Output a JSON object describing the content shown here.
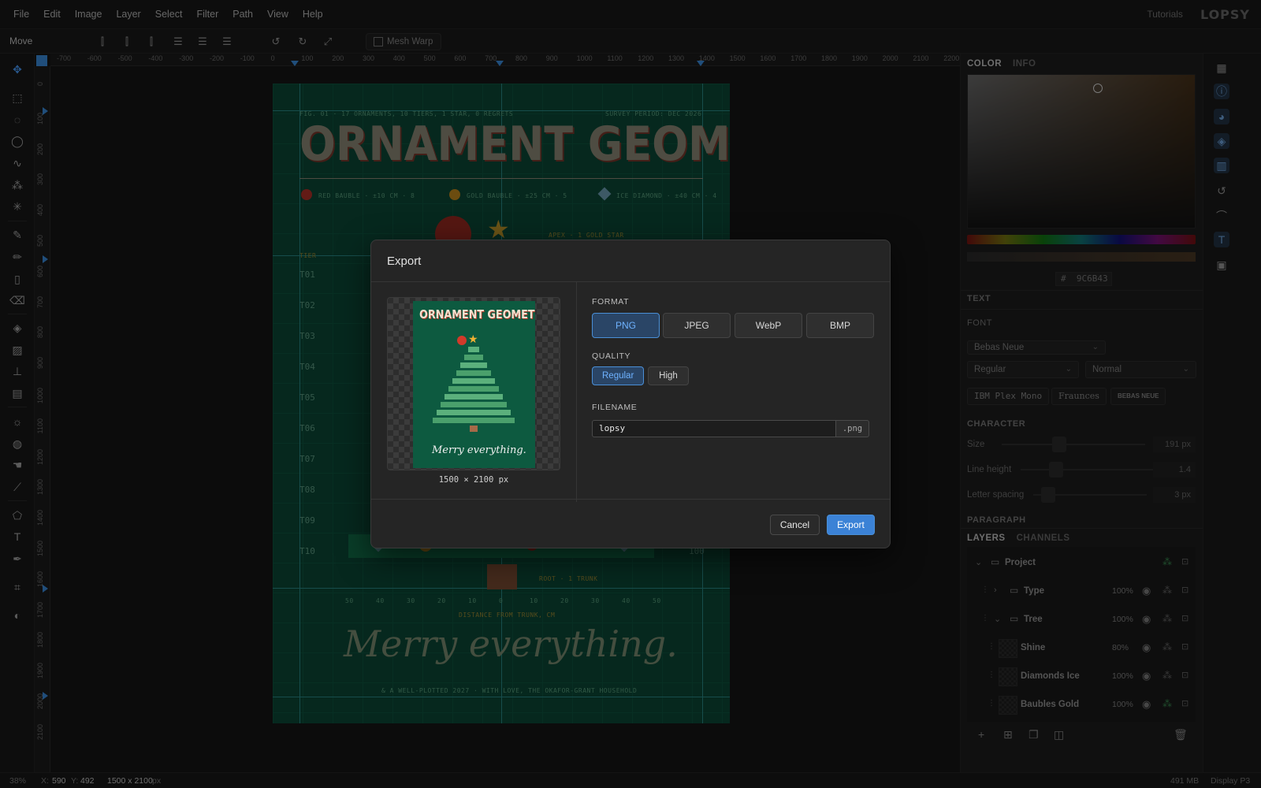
{
  "menubar": {
    "items": [
      "File",
      "Edit",
      "Image",
      "Layer",
      "Select",
      "Filter",
      "Path",
      "View",
      "Help"
    ],
    "tutorials": "Tutorials",
    "logo": "LOPSY"
  },
  "options": {
    "tool_name": "Move",
    "mesh_warp": "Mesh Warp"
  },
  "rulers": {
    "h": [
      "-700",
      "-600",
      "-500",
      "-400",
      "-300",
      "-200",
      "-100",
      "0",
      "100",
      "200",
      "300",
      "400",
      "500",
      "600",
      "700",
      "800",
      "900",
      "1000",
      "1100",
      "1200",
      "1300",
      "1400",
      "1500",
      "1600",
      "1700",
      "1800",
      "1900",
      "2000",
      "2100",
      "2200"
    ],
    "v": [
      "0",
      "100",
      "200",
      "300",
      "400",
      "500",
      "600",
      "700",
      "800",
      "900",
      "1000",
      "1100",
      "1200",
      "1300",
      "1400",
      "1500",
      "1600",
      "1700",
      "1800",
      "1900",
      "2000",
      "2100"
    ]
  },
  "poster": {
    "caption_left": "FIG. 01 · 17 ORNAMENTS, 10 TIERS, 1 STAR, 0 REGRETS",
    "caption_right": "SURVEY PERIOD: DEC 2026",
    "title": "ORNAMENT GEOMETRY",
    "legend": [
      "RED BAUBLE · ±10 CM · 8",
      "GOLD BAUBLE · ±25 CM · 5",
      "ICE DIAMOND · ±40 CM · 4"
    ],
    "apex": "APEX · 1 GOLD STAR",
    "tier_head": "TIER",
    "tiers": [
      "T01",
      "T02",
      "T03",
      "T04",
      "T05",
      "T06",
      "T07",
      "T08",
      "T09",
      "T10"
    ],
    "tier10_value": "100",
    "root": "ROOT · 1 TRUNK",
    "axis_ticks": [
      "50",
      "40",
      "30",
      "20",
      "10",
      "0",
      "10",
      "20",
      "30",
      "40",
      "50"
    ],
    "axis_label": "DISTANCE FROM TRUNK, CM",
    "merry": "Merry everything.",
    "footer": "& A WELL-PLOTTED 2027 · WITH LOVE, THE OKAFOR-GRANT HOUSEHOLD"
  },
  "panel": {
    "tab_color": "COLOR",
    "tab_info": "INFO",
    "hex": "9C6B43",
    "text_section": "TEXT",
    "font_label": "FONT",
    "font_family": "Bebas Neue",
    "font_weight": "Regular",
    "font_style": "Normal",
    "font_chips": [
      "IBM Plex Mono",
      "Fraunces",
      "BEBAS NEUE"
    ],
    "character_label": "CHARACTER",
    "size_label": "Size",
    "size_value": "191 px",
    "lineheight_label": "Line height",
    "lineheight_value": "1.4",
    "letterspacing_label": "Letter spacing",
    "letterspacing_value": "3 px",
    "paragraph_label": "PARAGRAPH",
    "tab_layers": "LAYERS",
    "tab_channels": "CHANNELS",
    "layers": [
      {
        "name": "Project",
        "opacity": ""
      },
      {
        "name": "Type",
        "opacity": "100%"
      },
      {
        "name": "Tree",
        "opacity": "100%"
      },
      {
        "name": "Shine",
        "opacity": "80%"
      },
      {
        "name": "Diamonds Ice",
        "opacity": "100%"
      },
      {
        "name": "Baubles Gold",
        "opacity": "100%"
      }
    ]
  },
  "status": {
    "zoom": "38%",
    "x_label": "X:",
    "x": "590",
    "y_label": "Y:",
    "y": "492",
    "size": "1500 x 2100",
    "size_unit": "px",
    "memory": "491 MB",
    "profile": "Display P3"
  },
  "modal": {
    "title": "Export",
    "preview_title": "ORNAMENT GEOMETRY",
    "preview_merry": "Merry everything.",
    "dimensions": "1500 × 2100 px",
    "format_label": "FORMAT",
    "formats": [
      "PNG",
      "JPEG",
      "WebP",
      "BMP"
    ],
    "selected_format": "PNG",
    "quality_label": "QUALITY",
    "qualities": [
      "Regular",
      "High"
    ],
    "selected_quality": "Regular",
    "filename_label": "FILENAME",
    "filename": "lopsy",
    "extension": ".png",
    "cancel": "Cancel",
    "export": "Export"
  },
  "colors": {
    "accent": "#3b82d6",
    "poster_bg": "#0c4a38",
    "title_fill": "#8e8a78"
  }
}
